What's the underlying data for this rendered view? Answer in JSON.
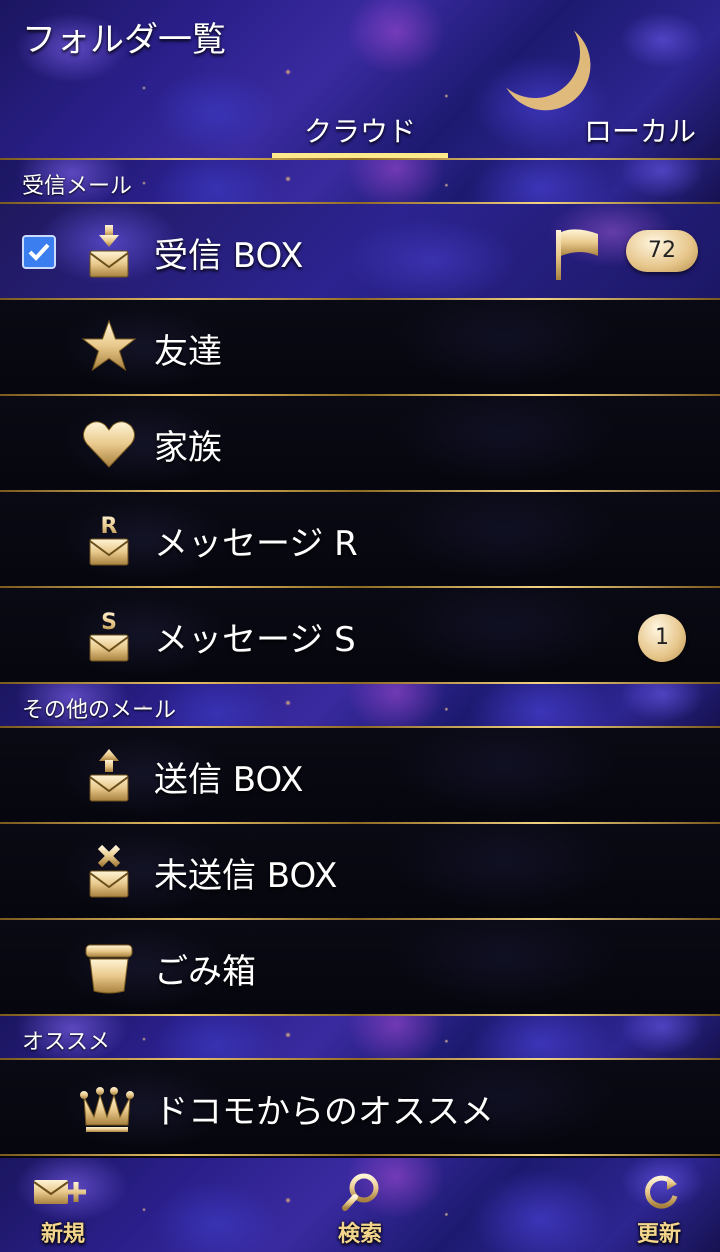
{
  "header": {
    "title": "フォルダ一覧",
    "tabs": [
      {
        "label": "クラウド",
        "active": true
      },
      {
        "label": "ローカル",
        "active": false
      }
    ]
  },
  "sections": [
    {
      "label": "受信メール"
    },
    {
      "label": "その他のメール"
    },
    {
      "label": "オススメ"
    }
  ],
  "folders": {
    "inbox": {
      "label": "受信 BOX",
      "icon": "inbox-icon",
      "checked": true,
      "badge": "72",
      "flag_icon": "flag-icon"
    },
    "friends": {
      "label": "友達",
      "icon": "star-icon"
    },
    "family": {
      "label": "家族",
      "icon": "heart-icon"
    },
    "message_r": {
      "label": "メッセージ R",
      "icon": "message-r-icon"
    },
    "message_s": {
      "label": "メッセージ S",
      "icon": "message-s-icon",
      "badge": "1"
    },
    "outbox": {
      "label": "送信 BOX",
      "icon": "outbox-icon"
    },
    "unsent": {
      "label": "未送信 BOX",
      "icon": "unsent-icon"
    },
    "trash": {
      "label": "ごみ箱",
      "icon": "trash-icon"
    },
    "recommend": {
      "label": "ドコモからのオススメ",
      "icon": "crown-icon"
    }
  },
  "bottom_bar": {
    "new": {
      "label": "新規",
      "icon": "new-mail-icon"
    },
    "search": {
      "label": "検索",
      "icon": "search-icon"
    },
    "refresh": {
      "label": "更新",
      "icon": "refresh-icon"
    }
  },
  "colors": {
    "gold": "#e7c16a",
    "tab_underline": "#ffe98a",
    "checkbox": "#3a7ef0"
  }
}
